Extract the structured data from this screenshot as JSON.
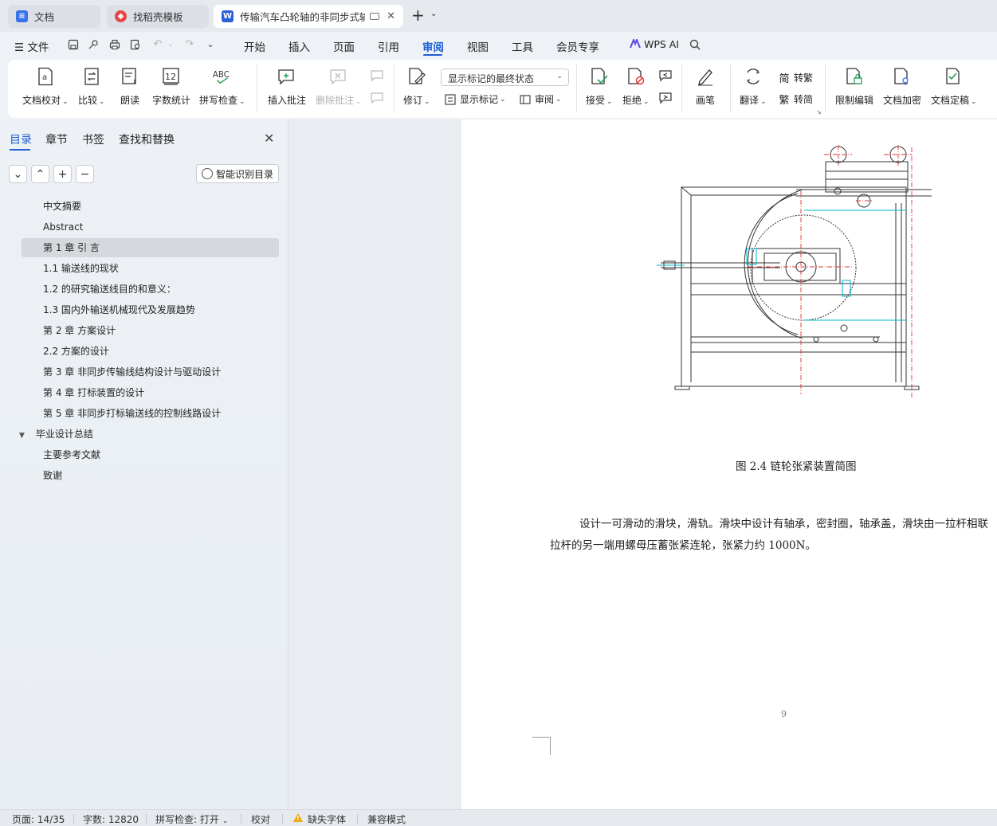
{
  "tabs": [
    {
      "label": "文档",
      "icon": "doc-icon",
      "color": "#3a73e8"
    },
    {
      "label": "找稻壳模板",
      "icon": "docer-icon",
      "color": "#e54545"
    },
    {
      "label": "传输汽车凸轮轴的非同步式输送",
      "icon": "word-doc-icon",
      "color": "#2b5fd9"
    }
  ],
  "menu": {
    "file": "文件",
    "items": [
      "开始",
      "插入",
      "页面",
      "引用",
      "审阅",
      "视图",
      "工具",
      "会员专享"
    ],
    "active": "审阅",
    "wps_ai": "WPS AI"
  },
  "ribbon": {
    "doc_proof": "文档校对",
    "compare": "比较",
    "read_aloud": "朗读",
    "word_count": "字数统计",
    "spell_check": "拼写检查",
    "insert_comment": "插入批注",
    "delete_comment": "删除批注",
    "track_changes": "修订",
    "markup_state": "显示标记的最终状态",
    "show_markup": "显示标记",
    "review_pane": "审阅",
    "accept": "接受",
    "reject": "拒绝",
    "pen": "画笔",
    "translate": "翻译",
    "to_traditional": "转繁",
    "to_simplified": "转简",
    "restrict_editing": "限制编辑",
    "doc_encrypt": "文档加密",
    "doc_finalize": "文档定稿",
    "word_count_icon_num": "12",
    "spell_icon_text": "ABC",
    "trad_glyph": "简",
    "simp_glyph": "繁"
  },
  "sidebar": {
    "tabs": [
      "目录",
      "章节",
      "书签",
      "查找和替换"
    ],
    "smart_toc": "智能识别目录",
    "toc": [
      {
        "label": "中文摘要",
        "level": 2
      },
      {
        "label": "Abstract",
        "level": 2
      },
      {
        "label": "第 1 章   引   言",
        "level": 2,
        "selected": true
      },
      {
        "label": "1.1 输送线的现状",
        "level": 2
      },
      {
        "label": "1.2 的研究输送线目的和意义：",
        "level": 2
      },
      {
        "label": "1.3   国内外输送机械现代及发展趋势",
        "level": 2
      },
      {
        "label": "第 2 章    方案设计",
        "level": 2
      },
      {
        "label": "2.2     方案的设计",
        "level": 2
      },
      {
        "label": "第 3 章   非同步传输线结构设计与驱动设计",
        "level": 2
      },
      {
        "label": "第 4 章    打标装置的设计",
        "level": 2
      },
      {
        "label": "第 5 章    非同步打标输送线的控制线路设计",
        "level": 2
      },
      {
        "label": "毕业设计总结",
        "level": 1,
        "expanded": true
      },
      {
        "label": "主要参考文献",
        "level": 2
      },
      {
        "label": "致谢",
        "level": 2
      }
    ]
  },
  "document": {
    "caption": "图 2.4 链轮张紧装置简图",
    "para_line1": "设计一可滑动的滑块，滑轨。滑块中设计有轴承，密封圈，轴承盖，滑块由一拉杆相联",
    "para_line2": "拉杆的另一端用螺母压蓄张紧连轮，张紧力约 1000N。",
    "page_number": "9"
  },
  "status": {
    "page": "页面: 14/35",
    "words": "字数: 12820",
    "spell": "拼写检查: 打开",
    "proof": "校对",
    "missing_fonts": "缺失字体",
    "compat": "兼容模式"
  },
  "colors": {
    "accent": "#1f5fd6",
    "drawing_cyan": "#00b4c8",
    "drawing_red": "#e03030"
  }
}
